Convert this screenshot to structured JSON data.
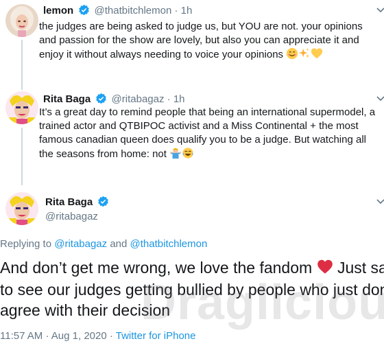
{
  "tweets": [
    {
      "name": "lemon",
      "handle": "@thatbitchlemon",
      "sep": "·",
      "time": "1h",
      "lines": [
        "the judges are being asked to judge us, but YOU are not. your opinions",
        "and passion for the show are lovely, but also you can appreciate it and",
        "enjoy it without always needing to voice your opinions"
      ],
      "emojis": [
        "smiling-face-icon",
        "sparkles-icon",
        "yellow-heart-icon"
      ]
    },
    {
      "name": "Rita Baga",
      "handle": "@ritabagaz",
      "sep": "·",
      "time": "1h",
      "lines": [
        "It’s a great day to remind people that being an international supermodel, a",
        "trained actor and QTBIPOC activist and a Miss Continental + the most",
        "famous canadian queen does qualify you to be a judge. But watching all",
        "the seasons from home: not"
      ],
      "emojis": [
        "person-shrugging-icon",
        "tears-of-joy-icon"
      ]
    }
  ],
  "main_tweet": {
    "name": "Rita Baga",
    "handle": "@ritabagaz",
    "replying_prefix": "Replying to",
    "replying_user1": "@ritabagaz",
    "replying_and": "and",
    "replying_user2": "@thatbitchlemon",
    "lines": [
      "And don’t get me wrong, we love the fandom",
      "Just sad",
      "to see our judges getting bullied by people who just don’t",
      "agree with their decision"
    ],
    "emoji": "red-heart-icon",
    "time": "11:57 AM",
    "dot": "·",
    "date": "Aug 1, 2020",
    "source": "Twitter for iPhone"
  },
  "watermark": "Draglicious",
  "colors": {
    "link": "#1b95e0",
    "muted": "#657786",
    "verified": "#1da1f2",
    "heart": "#e0245e"
  }
}
